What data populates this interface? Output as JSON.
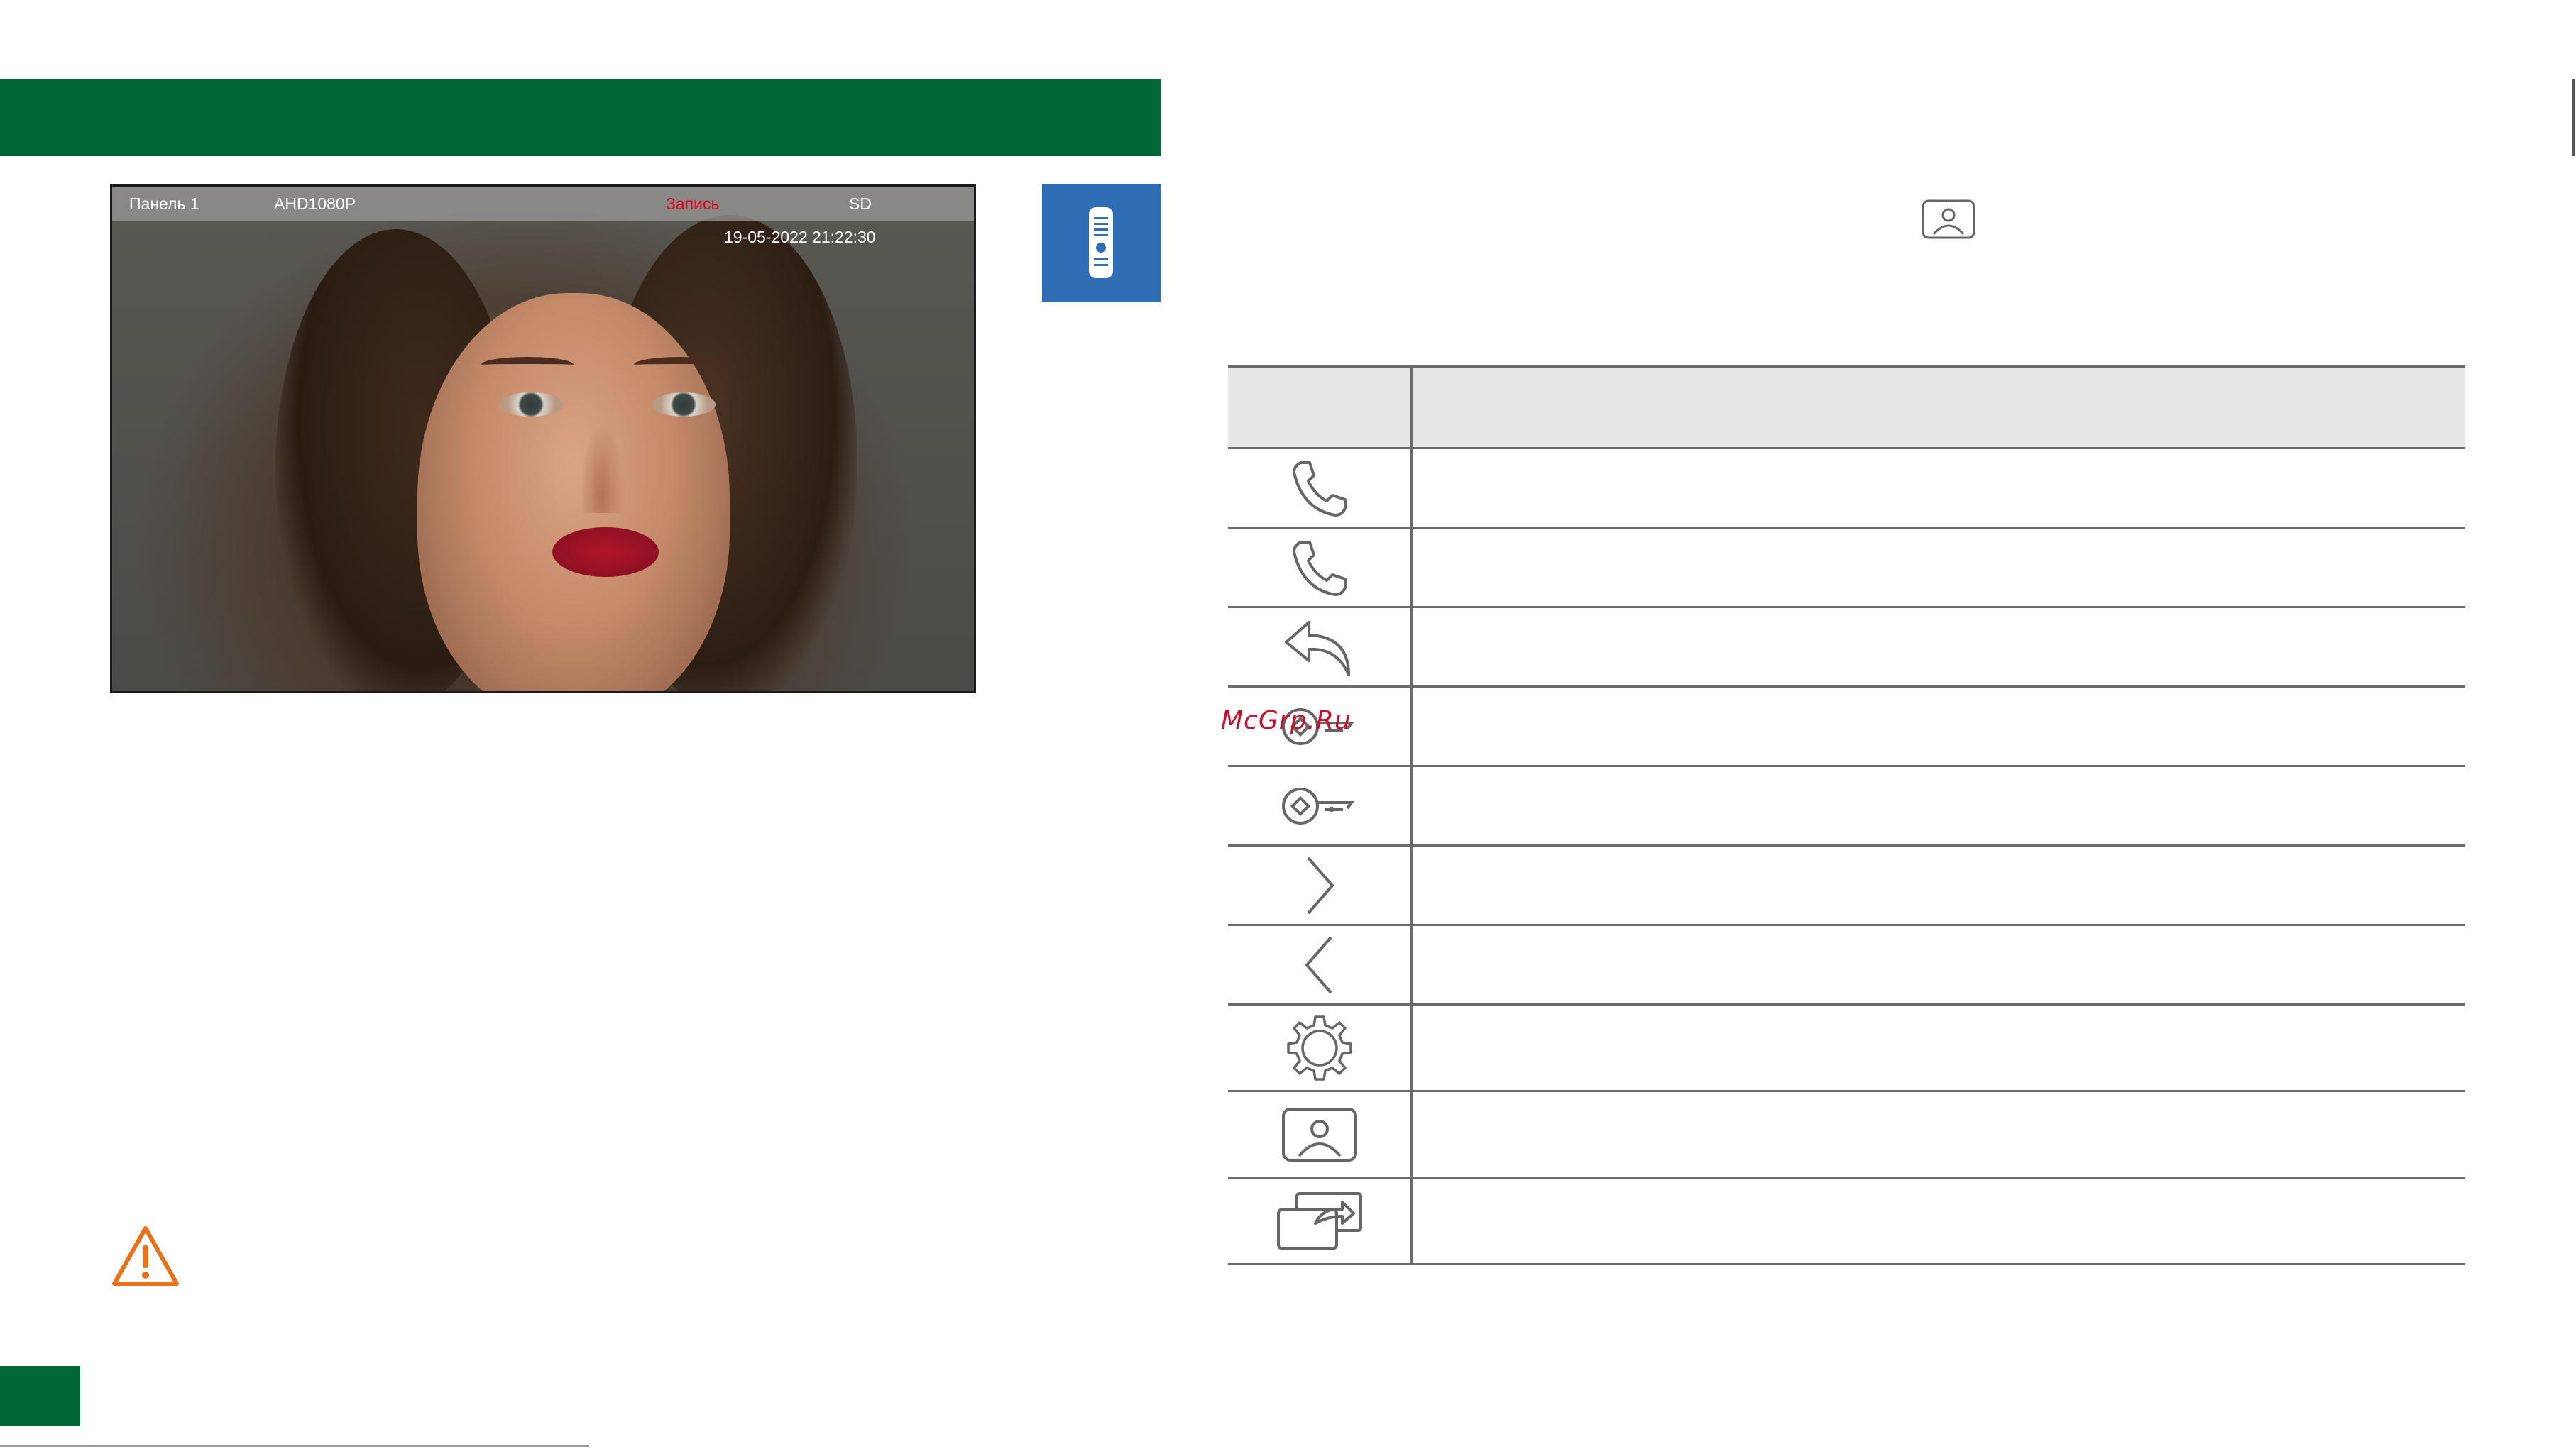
{
  "screen": {
    "panel_label": "Панель 1",
    "resolution": "AHD1080P",
    "record_label": "Запись",
    "storage_label": "SD",
    "datetime": "19-05-2022 21:22:30"
  },
  "watermark": "McGrp.Ru",
  "icon_table": {
    "rows": [
      {
        "icon": "phone-answer-icon"
      },
      {
        "icon": "phone-hangup-icon"
      },
      {
        "icon": "back-arrow-icon"
      },
      {
        "icon": "key-lock-1-icon"
      },
      {
        "icon": "key-lock-2-icon"
      },
      {
        "icon": "chevron-right-icon"
      },
      {
        "icon": "chevron-left-icon"
      },
      {
        "icon": "gear-icon"
      },
      {
        "icon": "photo-icon"
      },
      {
        "icon": "transfer-icon"
      }
    ]
  },
  "colors": {
    "header_green": "#006837",
    "door_button_blue": "#2f6db5",
    "record_red": "#e3061b",
    "warning_orange": "#e8711a"
  }
}
